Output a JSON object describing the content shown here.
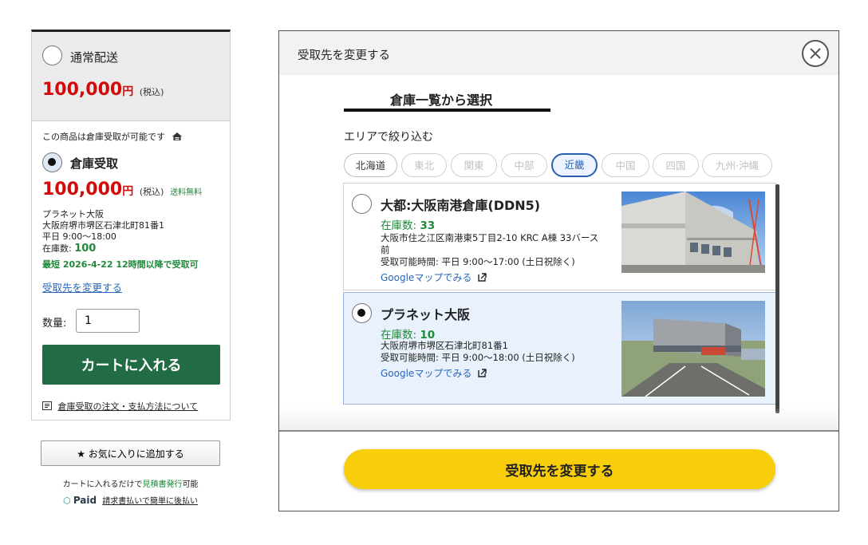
{
  "left_panel": {
    "normal_delivery": {
      "label": "通常配送",
      "price": "100,000",
      "yen": "円",
      "tax": "(税込)"
    },
    "warehouse_available": "この商品は倉庫受取が可能です",
    "warehouse_pickup": {
      "label": "倉庫受取",
      "price": "100,000",
      "yen": "円",
      "tax": "(税込)",
      "free_shipping": "送料無料"
    },
    "store": {
      "name": "プラネット大阪",
      "address": "大阪府堺市堺区石津北町81番1",
      "hours": "平日 9:00～18:00",
      "stock_label": "在庫数:",
      "stock_value": "100",
      "earliest": "最短 2026-4-22 12時間以降で受取可"
    },
    "change_link": "受取先を変更する",
    "quantity_label": "数量:",
    "quantity_value": "1",
    "cart_button": "カートに入れる",
    "order_info": "倉庫受取の注文・支払方法について",
    "favorite_button": "★ お気に入りに追加する",
    "estimate_note_prefix": "カートに入れるだけで",
    "estimate_note_link": "見積書発行",
    "estimate_note_suffix": "可能",
    "paid_logo": "Paid",
    "paid_link": "請求書払いで簡単に後払い"
  },
  "modal": {
    "title": "受取先を変更する",
    "tab": "倉庫一覧から選択",
    "area_label": "エリアで絞り込む",
    "areas": [
      {
        "label": "北海道",
        "state": "enabled"
      },
      {
        "label": "東北",
        "state": "disabled"
      },
      {
        "label": "関東",
        "state": "disabled"
      },
      {
        "label": "中部",
        "state": "disabled"
      },
      {
        "label": "近畿",
        "state": "active"
      },
      {
        "label": "中国",
        "state": "disabled"
      },
      {
        "label": "四国",
        "state": "disabled"
      },
      {
        "label": "九州·沖縄",
        "state": "disabled"
      }
    ],
    "warehouses": [
      {
        "name": "大都:大阪南港倉庫(DDN5)",
        "stock_label": "在庫数:",
        "stock_value": "33",
        "address_line1": "大阪市住之江区南港東5丁目2-10 KRC A棟 33バース",
        "address_line2": "前",
        "hours": "受取可能時間: 平日 9:00～17:00 (土日祝除く)",
        "map_link": "Googleマップでみる",
        "selected": false
      },
      {
        "name": "プラネット大阪",
        "stock_label": "在庫数:",
        "stock_value": "10",
        "address_line1": "大阪府堺市堺区石津北町81番1",
        "hours": "受取可能時間: 平日 9:00～18:00 (土日祝除く)",
        "map_link": "Googleマップでみる",
        "selected": true
      }
    ],
    "submit_button": "受取先を変更する"
  },
  "colors": {
    "price_red": "#d20a0a",
    "stock_green": "#1f8a3a",
    "cart_green": "#216b45",
    "link_blue": "#2a66b5",
    "submit_yellow": "#f8cd0a",
    "active_area_blue": "#2a5fb0"
  }
}
